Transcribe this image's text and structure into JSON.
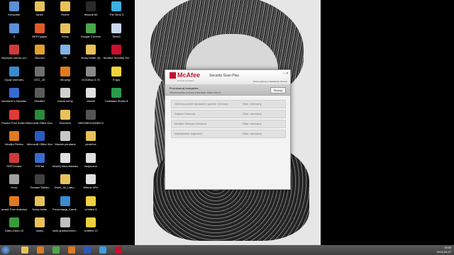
{
  "desktop": {
    "icons": [
      {
        "label": "Komputer",
        "color": "#5b8fd6"
      },
      {
        "label": "fanes",
        "color": "#e8c15a"
      },
      {
        "label": "Różne",
        "color": "#e8c15a"
      },
      {
        "label": "Wszedł 84",
        "color": "#2a2a2a"
      },
      {
        "label": "The Sims 3",
        "color": "#3cb0e0"
      },
      {
        "label": "3",
        "color": "#5b8fd6"
      },
      {
        "label": "BESTplayer",
        "color": "#e05a2a"
      },
      {
        "label": "Nowy",
        "color": "#e8c15a"
      },
      {
        "label": "Google Chrome",
        "color": "#4aa84a"
      },
      {
        "label": "Sims3",
        "color": "#c9d7f0"
      },
      {
        "label": "Wyczyść rzeczy za darmo",
        "color": "#d03a3a"
      },
      {
        "label": "BALord",
        "color": "#e0a030"
      },
      {
        "label": "PK",
        "color": "#7fb3e6"
      },
      {
        "label": "Nowy folder (3)",
        "color": "#e8c15a"
      },
      {
        "label": "McAfee Security Scan Plus",
        "color": "#c8102e"
      },
      {
        "label": "Opcje internetu",
        "color": "#3a8ad0"
      },
      {
        "label": "DSC_1E",
        "color": "#6e6e6e"
      },
      {
        "label": "Winamp",
        "color": "#e07a20"
      },
      {
        "label": "DCIDBox 0.74",
        "color": "#8a8a8a"
      },
      {
        "label": "Fraps",
        "color": "#f2d23a"
      },
      {
        "label": "cardiacor's Karaoke Player",
        "color": "#3a6ad0"
      },
      {
        "label": "HitedM1",
        "color": "#5a5a5a"
      },
      {
        "label": "mania komp",
        "color": "#d0d0d0"
      },
      {
        "label": "Vaesle",
        "color": "#e0e0e0"
      },
      {
        "label": "Camtasia Studio 8",
        "color": "#2a9a4a"
      },
      {
        "label": "Pazera Free Audio Extractor",
        "color": "#e03a3a"
      },
      {
        "label": "Microsoft Office Excel 2007",
        "color": "#2a8a3a"
      },
      {
        "label": "Rzeżnice",
        "color": "#e8c15a"
      },
      {
        "label": "MDI20801024B00.5",
        "color": "#555555"
      },
      {
        "label": "",
        "color": "#000000"
      },
      {
        "label": "Mozilla Firefox",
        "color": "#e07a20"
      },
      {
        "label": "Microsoft Office Word 2007",
        "color": "#2a5ac0"
      },
      {
        "label": "Maciek pendane",
        "color": "#c8c8c8"
      },
      {
        "label": "pendrive",
        "color": "#e8c15a"
      },
      {
        "label": "",
        "color": "#000000"
      },
      {
        "label": "PDFCreator",
        "color": "#d03a3a"
      },
      {
        "label": "PSPad",
        "color": "#3a6ad0"
      },
      {
        "label": "Maciej Mazurkiewicz ...",
        "color": "#e0e0e0"
      },
      {
        "label": "twojeczne",
        "color": "#e0e0e0"
      },
      {
        "label": "",
        "color": "#000000"
      },
      {
        "label": "Kosz",
        "color": "#a0a0a0"
      },
      {
        "label": "Tomasz Stańko",
        "color": "#404040"
      },
      {
        "label": "Duże_do_Laku...",
        "color": "#e8c15a"
      },
      {
        "label": "Mikroś viPe",
        "color": "#e0e0e0"
      },
      {
        "label": "",
        "color": "#000000"
      },
      {
        "label": "avast! Free Antivirus",
        "color": "#e07a20"
      },
      {
        "label": "Nowy folder",
        "color": "#e8c15a"
      },
      {
        "label": "Prezentacja_Kamil...",
        "color": "#3a8ad0"
      },
      {
        "label": "Untitled 8",
        "color": "#f0d040"
      },
      {
        "label": "",
        "color": "#000000"
      },
      {
        "label": "Gadu-Gadu 10",
        "color": "#3a9a3a"
      },
      {
        "label": "skany",
        "color": "#e8c15a"
      },
      {
        "label": "skok spadochrono...",
        "color": "#c0c0c0"
      },
      {
        "label": "Untitled 12",
        "color": "#f0d040"
      }
    ]
  },
  "window": {
    "brand": "McAfee",
    "brand_sub": "An Intel Company",
    "product": "Security Scan Plus",
    "controls": "– ✕",
    "nav": "Strona główna | Ustawienia | Pomoc",
    "banner_title": "Przeskanuj komputer.",
    "banner_subtitle": "Skanowanie potrwa zaledwie kilka minut.",
    "scan_button": "Skanuj",
    "rows": [
      {
        "name": "Ochrona przed wirusami i typowe Ochrona",
        "status": "Stan: nieznany"
      },
      {
        "name": "Zapora Ochrona",
        "status": "Stan: nieznany"
      },
      {
        "name": "McAfee Witryna Ochrona",
        "status": "Stan: nieznany"
      },
      {
        "name": "Wykrywanie zagrożeń",
        "status": "Stan: nieznany"
      }
    ]
  },
  "taskbar": {
    "apps": [
      {
        "name": "windows-explorer-icon",
        "color": "#e8c15a"
      },
      {
        "name": "media-player-icon",
        "color": "#e07a20"
      },
      {
        "name": "chrome-icon",
        "color": "#4aa84a"
      },
      {
        "name": "firefox-icon",
        "color": "#e07a20"
      },
      {
        "name": "word-icon",
        "color": "#2a5ac0"
      },
      {
        "name": "skype-icon",
        "color": "#3aa0e0"
      },
      {
        "name": "mcafee-icon",
        "color": "#c8102e"
      }
    ],
    "time": "19:59",
    "date": "2013-02-07"
  }
}
